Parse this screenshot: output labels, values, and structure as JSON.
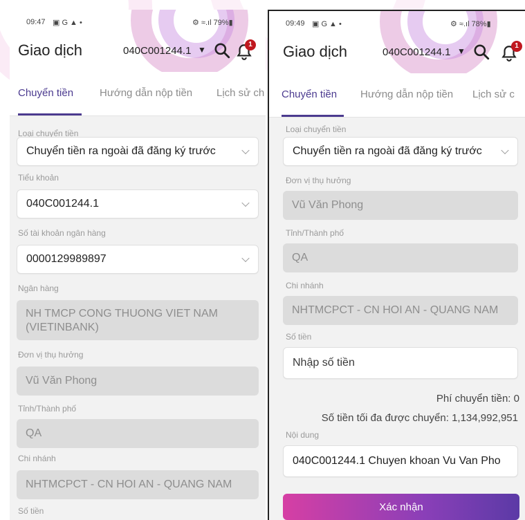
{
  "left": {
    "status": {
      "time": "09:47",
      "status_icons": "▣ G ▲ •",
      "battery": "⚙ ≈.ıl 79%▮"
    },
    "header": {
      "title": "Giao dịch",
      "account": "040C001244.1",
      "caret": "▼",
      "badge_count": "1"
    },
    "tabs": [
      {
        "label": "Chuyển tiền"
      },
      {
        "label": "Hướng dẫn nộp tiền"
      },
      {
        "label": "Lịch sử ch"
      }
    ],
    "form": {
      "transfer_type": {
        "label": "Loại chuyển tiền",
        "value": "Chuyển tiền ra ngoài đã đăng ký trước"
      },
      "sub_account": {
        "label": "Tiểu khoản",
        "value": "040C001244.1"
      },
      "bank_account": {
        "label": "Số tài khoản ngân hàng",
        "value": "0000129989897"
      },
      "bank": {
        "label": "Ngân hàng",
        "value_line1": "NH TMCP CONG THUONG VIET NAM",
        "value_line2": "(VIETINBANK)"
      },
      "beneficiary": {
        "label": "Đơn vị thụ hưởng",
        "value": "Vũ Văn Phong"
      },
      "province": {
        "label": "Tỉnh/Thành phố",
        "value": "QA"
      },
      "branch": {
        "label": "Chi nhánh",
        "value": "NHTMCPCT - CN HOI AN - QUANG NAM"
      },
      "amount": {
        "label": "Số tiền"
      }
    }
  },
  "right": {
    "status": {
      "time": "09:49",
      "status_icons": "▣ G ▲ •",
      "battery": "⚙ ≈.ıl 78%▮"
    },
    "header": {
      "title": "Giao dịch",
      "account": "040C001244.1",
      "caret": "▼",
      "badge_count": "1"
    },
    "tabs": [
      {
        "label": "Chuyển tiền"
      },
      {
        "label": "Hướng dẫn nộp tiền"
      },
      {
        "label": "Lịch sử c"
      }
    ],
    "form": {
      "transfer_type": {
        "label": "Loại chuyển tiền",
        "value": "Chuyển tiền ra ngoài đã đăng ký trước"
      },
      "beneficiary": {
        "label": "Đơn vị thụ hưởng",
        "value": "Vũ Văn Phong"
      },
      "province": {
        "label": "Tỉnh/Thành phố",
        "value": "QA"
      },
      "branch": {
        "label": "Chi nhánh",
        "value": "NHTMCPCT - CN HOI AN - QUANG NAM"
      },
      "amount": {
        "label": "Số tiền",
        "placeholder": "Nhập số tiền"
      },
      "fee_text": "Phí chuyển tiền: 0",
      "max_text": "Số tiền tối đa được chuyển: 1,134,992,951",
      "content": {
        "label": "Nội dung",
        "value": "040C001244.1 Chuyen khoan Vu Van Pho"
      },
      "confirm_label": "Xác nhận"
    }
  },
  "colors": {
    "accent": "#4b3a8f",
    "readonly_bg": "#dcdcdc",
    "badge": "#c0181f",
    "button_start": "#d63fa4",
    "button_end": "#5b3aa6"
  }
}
